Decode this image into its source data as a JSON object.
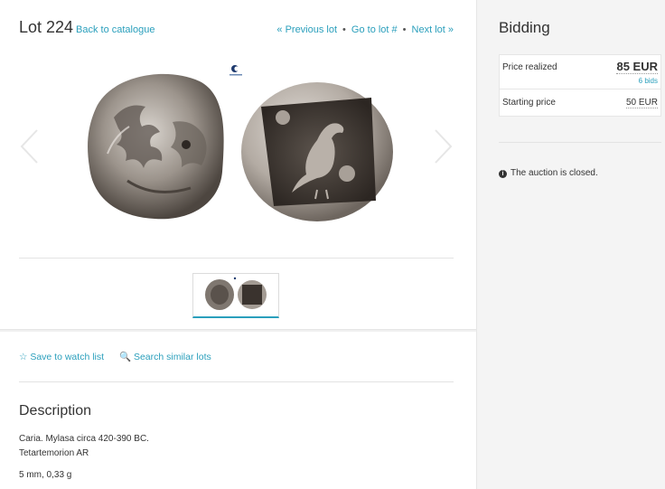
{
  "lot": {
    "title": "Lot 224",
    "back_link": "Back to catalogue",
    "nav": {
      "previous": "« Previous lot",
      "goto": "Go to lot #",
      "next": "Next lot »",
      "separator": "•"
    }
  },
  "gallery": {
    "prev_arrow_icon": "chevron-left-icon",
    "next_arrow_icon": "chevron-right-icon",
    "images": [
      "coin-obverse-lion",
      "coin-reverse-eagle"
    ]
  },
  "actions": {
    "watch": "☆ Save to watch list",
    "search": "🔍 Search similar lots",
    "watch_label": "Save to watch list",
    "search_label": "Search similar lots"
  },
  "description": {
    "heading": "Description",
    "line1": "Caria. Mylasa circa 420-390 BC.",
    "line2": "Tetartemorion AR",
    "line3": "5 mm, 0,33 g"
  },
  "bidding": {
    "heading": "Bidding",
    "price_realized_label": "Price realized",
    "price_realized_value": "85 EUR",
    "bids": "6 bids",
    "starting_price_label": "Starting price",
    "starting_price_value": "50 EUR",
    "status": "The auction is closed."
  },
  "colors": {
    "link": "#2a9fbc",
    "text": "#333333",
    "sidebar_bg": "#f4f4f4"
  }
}
